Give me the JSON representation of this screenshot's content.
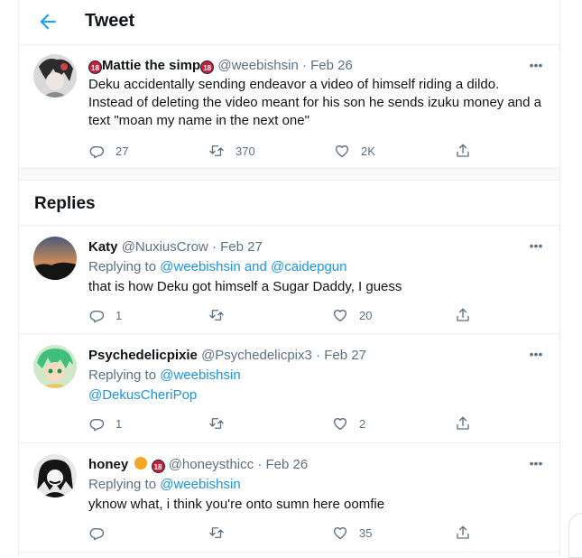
{
  "header": {
    "title": "Tweet"
  },
  "main_tweet": {
    "name": "Mattie the simp",
    "name_badge": "18",
    "handle": "@weebishsin",
    "date": "Feb 26",
    "text": "Deku accidentally sending endeavor a video of himself riding a dildo. Instead of deleting the video meant for his son he sends izuku money and a text \"moan my name in the next one\"",
    "replies": "27",
    "retweets": "370",
    "likes": "2K"
  },
  "replies_heading": "Replies",
  "replies": [
    {
      "name": "Katy",
      "handle": "@NuxiusCrow",
      "date": "Feb 27",
      "replying_prefix": "Replying to ",
      "replying_to": "@weebishsin and @caidepgun",
      "text": "that is how Deku got himself a Sugar Daddy, I guess",
      "replies": "1",
      "retweets": "",
      "likes": "20"
    },
    {
      "name": "Psychedelicpixie",
      "handle": "@Psychedelicpix3",
      "date": "Feb 27",
      "replying_prefix": "Replying to ",
      "replying_to": "@weebishsin",
      "text": "@DekusCheriPop",
      "replies": "1",
      "retweets": "",
      "likes": "2"
    },
    {
      "name": "honey",
      "name_badge": "18",
      "handle": "@honeysthicc",
      "date": "Feb 26",
      "replying_prefix": "Replying to ",
      "replying_to": "@weebishsin",
      "text": "yknow what, i think you're onto sumn here oomfie",
      "replies": "",
      "retweets": "",
      "likes": "35"
    }
  ],
  "dot": "·",
  "more": "•••",
  "colors": {
    "accent": "#1da1f2",
    "link": "#1b95e0",
    "muted": "#5b7083",
    "badge": "#c91d3e"
  },
  "icons": [
    "back-arrow-icon",
    "more-icon",
    "reply-icon",
    "retweet-icon",
    "like-icon",
    "share-icon"
  ]
}
